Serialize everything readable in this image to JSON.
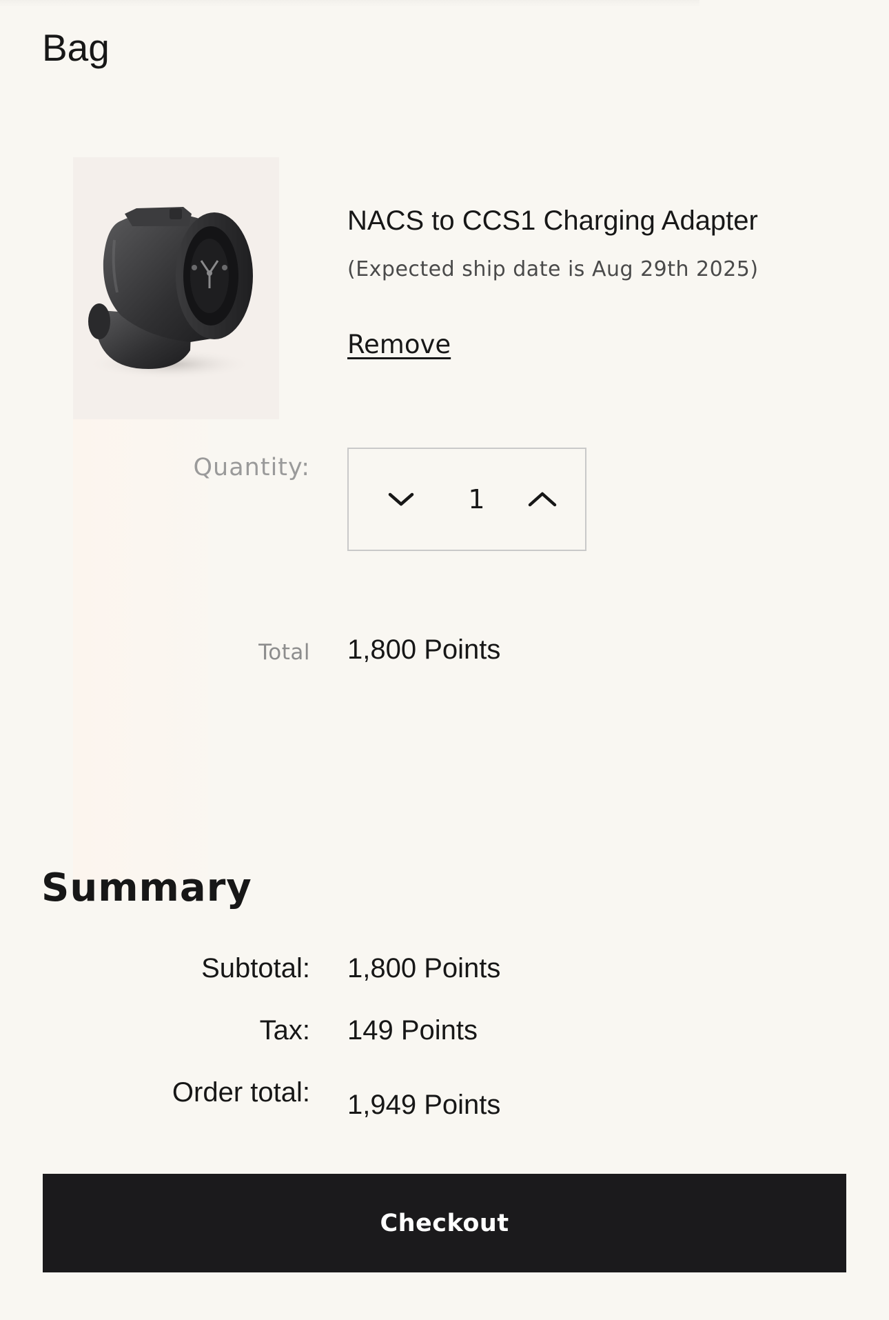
{
  "bag": {
    "title": "Bag"
  },
  "item": {
    "image_icon": "charging-adapter-product-image",
    "name": "NACS to CCS1 Charging Adapter",
    "ship_date": "(Expected ship date is Aug 29th 2025)",
    "remove_label": "Remove",
    "quantity_label": "Quantity:",
    "quantity_value": "1",
    "decrease_icon": "chevron-down-icon",
    "increase_icon": "chevron-up-icon",
    "total_label": "Total",
    "total_value": "1,800 Points"
  },
  "summary": {
    "title": "Summary",
    "rows": [
      {
        "label": "Subtotal:",
        "value": "1,800 Points"
      },
      {
        "label": "Tax:",
        "value": "149 Points"
      },
      {
        "label": "Order total:",
        "value": "1,949 Points"
      }
    ]
  },
  "checkout": {
    "label": "Checkout"
  },
  "colors": {
    "background": "#f9f7f2",
    "text": "#171717",
    "muted_text": "#9a9a9a",
    "button_bg": "#1b1a1c",
    "button_text": "#ffffff",
    "stepper_border": "#c9c9c9"
  }
}
